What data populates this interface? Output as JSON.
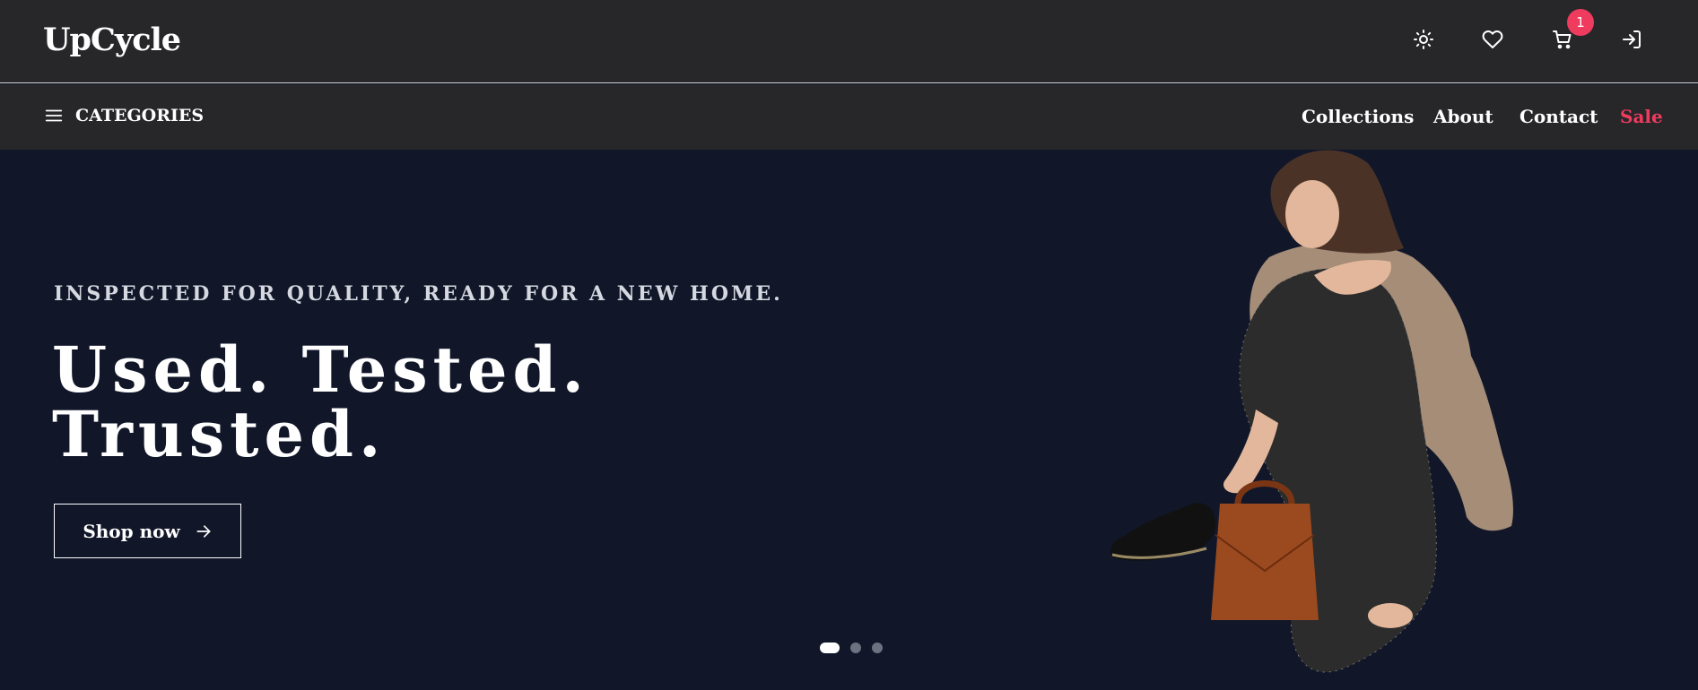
{
  "header": {
    "logo": "UpCycle",
    "icons": [
      "sun-icon",
      "heart-icon",
      "cart-icon",
      "login-icon"
    ],
    "cart_count": "1"
  },
  "nav": {
    "categories_label": "CATEGORIES",
    "links": [
      "Collections",
      "About",
      "Contact",
      "Sale"
    ]
  },
  "hero": {
    "tagline": "INSPECTED FOR QUALITY, READY FOR A NEW HOME.",
    "headline_line1": "Used. Tested.",
    "headline_line2": "Trusted.",
    "cta_label": "Shop now",
    "slides": 3,
    "active_slide": 1
  },
  "colors": {
    "topbar_bg": "#27272a",
    "hero_bg": "#111729",
    "accent": "#ef3b5d",
    "text": "#ffffff"
  }
}
